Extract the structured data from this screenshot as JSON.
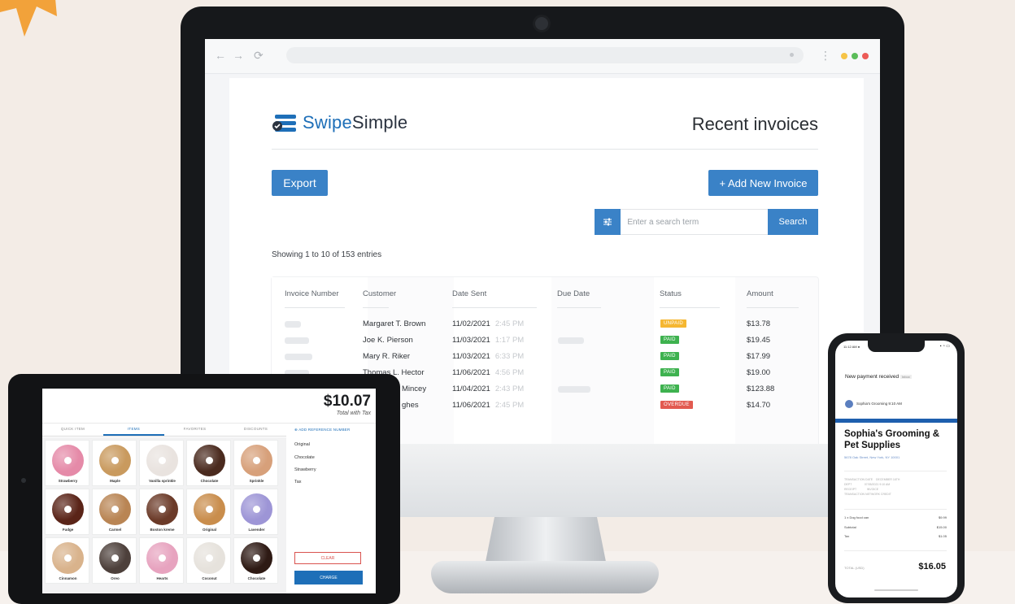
{
  "colors": {
    "accent": "#3a82c7",
    "brand": "#1e6fb8",
    "paid": "#3eb24f",
    "unpaid": "#f5b731",
    "overdue": "#e25a50"
  },
  "monitor": {
    "browser": {
      "back": "←",
      "forward": "→",
      "reload": "⟳",
      "menu": "⋮"
    },
    "logo": {
      "swipe": "Swipe",
      "simple": "Simple"
    },
    "title": "Recent invoices",
    "export_label": "Export",
    "add_label": "+  Add New Invoice",
    "search": {
      "placeholder": "Enter a search term",
      "button": "Search",
      "filter_icon": "sliders-icon"
    },
    "showing": "Showing 1 to 10 of 153 entries",
    "table": {
      "headers": [
        "Invoice Number",
        "Customer",
        "Date Sent",
        "Due Date",
        "Status",
        "Amount"
      ],
      "rows": [
        {
          "customer": "Margaret T. Brown",
          "date": "11/02/2021",
          "time": "2:45 PM",
          "status": "UNPAID",
          "amount": "$13.78"
        },
        {
          "customer": "Joe K. Pierson",
          "date": "11/03/2021",
          "time": "1:17 PM",
          "status": "PAID",
          "amount": "$19.45"
        },
        {
          "customer": "Mary R. Riker",
          "date": "11/03/2021",
          "time": "6:33 PM",
          "status": "PAID",
          "amount": "$17.99"
        },
        {
          "customer": "Thomas L. Hector",
          "date": "11/06/2021",
          "time": "4:56 PM",
          "status": "PAID",
          "amount": "$19.00"
        },
        {
          "customer": "Mincey",
          "date": "11/04/2021",
          "time": "2:43 PM",
          "status": "PAID",
          "amount": "$123.88"
        },
        {
          "customer": "ghes",
          "date": "11/06/2021",
          "time": "2:45 PM",
          "status": "OVERDUE",
          "amount": "$14.70"
        }
      ]
    }
  },
  "tablet": {
    "total": "$10.07",
    "total_label": "Total with Tax",
    "tabs": [
      "QUICK ITEM",
      "ITEMS",
      "FAVORITES",
      "DISCOUNTS"
    ],
    "add_reference": "ADD REFERENCE NUMBER",
    "options": [
      "Original",
      "Chocolate",
      "Strawberry",
      "Tax"
    ],
    "items": [
      {
        "label": "Strawberry",
        "color": "#e58aa8"
      },
      {
        "label": "Maple",
        "color": "#c99a5e"
      },
      {
        "label": "Vanilla sprinkle",
        "color": "#e9e3df"
      },
      {
        "label": "Chocolate",
        "color": "#4a2a1e"
      },
      {
        "label": "Sprinkle",
        "color": "#d7a07a"
      },
      {
        "label": "Fudge",
        "color": "#5a2418"
      },
      {
        "label": "Carmel",
        "color": "#b98554"
      },
      {
        "label": "Boston kreme",
        "color": "#6b3a28"
      },
      {
        "label": "Original",
        "color": "#c98d4c"
      },
      {
        "label": "Lavender",
        "color": "#9d95d6"
      },
      {
        "label": "Cinnamon",
        "color": "#d9b38c"
      },
      {
        "label": "Oreo",
        "color": "#4d403b"
      },
      {
        "label": "Hearts",
        "color": "#e7a3bf"
      },
      {
        "label": "Coconut",
        "color": "#e6e2dc"
      },
      {
        "label": "Chocolate",
        "color": "#2e1a14"
      }
    ],
    "clear_label": "CLEAR",
    "charge_label": "CHARGE"
  },
  "phone": {
    "status_left": "11:12 AM ●",
    "status_right": "▪ ◔ ▭",
    "subject": "New payment received",
    "inbox_tag": "Inbox",
    "sender": "Sophia's Grooming   9:10 AM",
    "business": "Sophia's Grooming & Pet Supplies",
    "address": "5678 Oak Street, New York, NY 10001",
    "details": "TRANSACTION DATE    DECEMBER 16TH\nDEPT                07/05/2021 9:10 AM\nRECEIPT             INVOICE\nTRANSACTION NETWORK CREDIT",
    "lines": [
      {
        "label": "1 x Dog food can",
        "value": "$9.99"
      },
      {
        "label": "Subtotal",
        "value": "$15.00"
      },
      {
        "label": "Tax",
        "value": "$1.05"
      }
    ],
    "total_label": "TOTAL (USD)",
    "total": "$16.05"
  }
}
